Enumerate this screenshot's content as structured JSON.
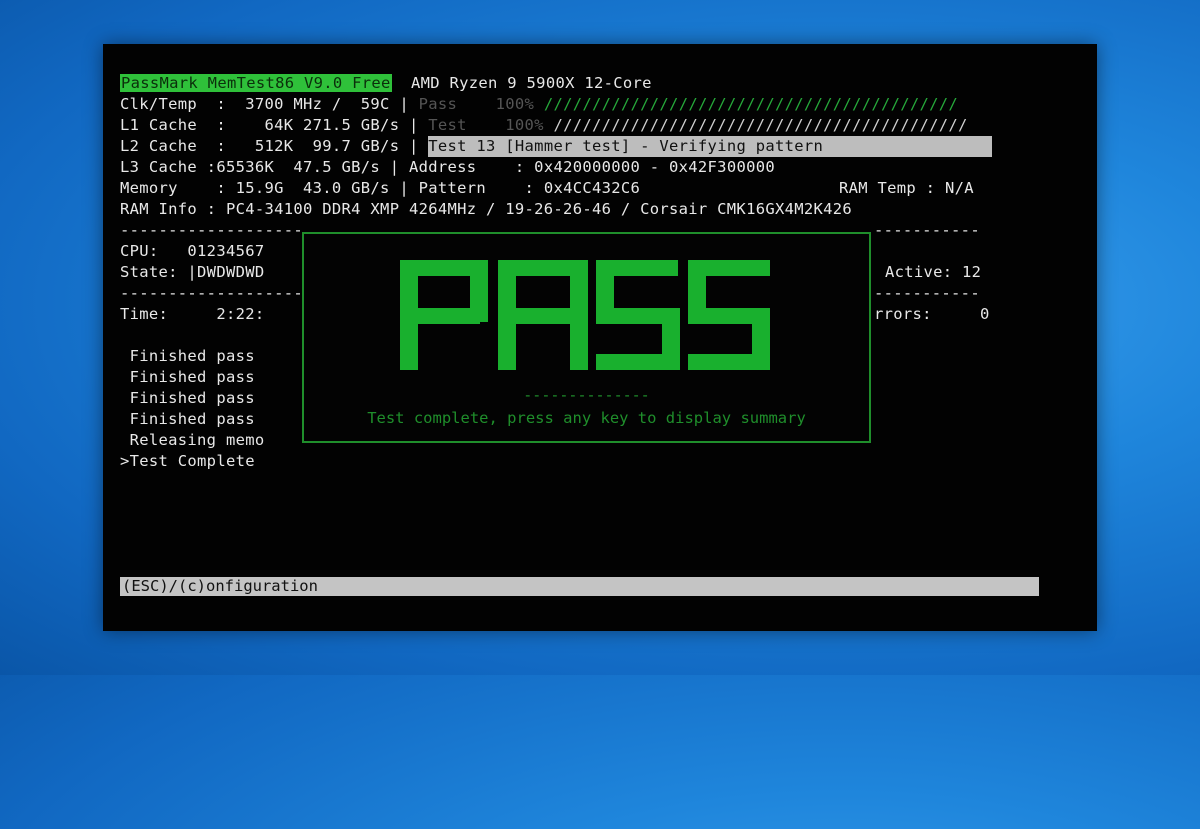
{
  "header": {
    "title": "PassMark MemTest86 V9.0 Free",
    "cpu_name": "AMD Ryzen 9 5900X 12-Core"
  },
  "system_info": {
    "clk_temp": "Clk/Temp  :  3700 MHz /  59C |",
    "l1": "L1 Cache  :    64K 271.5 GB/s |",
    "l2": "L2 Cache  :   512K  99.7 GB/s |",
    "l3": "L3 Cache :65536K  47.5 GB/s |",
    "memory": "Memory    : 15.9G  43.0 GB/s |",
    "ram_info": "RAM Info : PC4-34100 DDR4 XMP 4264MHz / 19-26-26-46 / Corsair CMK16GX4M2K426"
  },
  "progress": {
    "pass_label": "Pass    100%",
    "pass_value": 1.0,
    "test_label": "Test    100%",
    "test_value": 1.0,
    "current_test": "Test 13 [Hammer test] - Verifying pattern",
    "address": "Address    : 0x420000000 - 0x42F300000",
    "pattern": "Pattern    : 0x4CC432C6",
    "ram_temp": "RAM Temp : N/A"
  },
  "dividers": {
    "left": "-------------------",
    "right": "-----------"
  },
  "status": {
    "cpu": "CPU:   01234567",
    "state": "State: |DWDWDWD",
    "active": "Active: 12",
    "time": "Time:     2:22:",
    "errors": "rrors:     0"
  },
  "log": [
    " Finished pass",
    " Finished pass",
    " Finished pass",
    " Finished pass",
    " Releasing memo",
    ">Test Complete"
  ],
  "result_dialog": {
    "result": "PASS",
    "dashes": "--------------",
    "message": "Test complete, press any key to display summary"
  },
  "footer": {
    "label": "(ESC)/(c)onfiguration"
  },
  "colors": {
    "accent_green": "#2fc13a",
    "pass_green": "#19b02e",
    "desktop_blue": "#1f86dc"
  }
}
